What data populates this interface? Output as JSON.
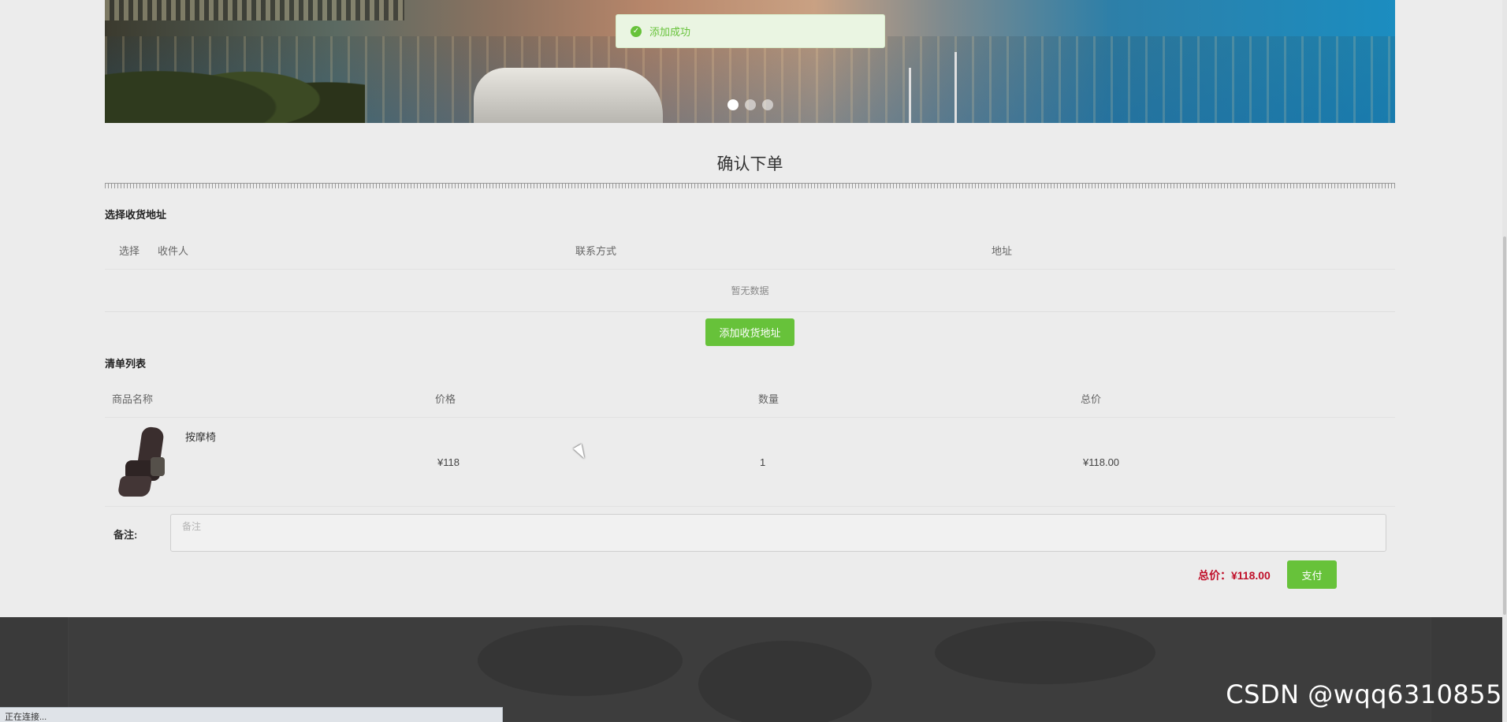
{
  "toast": {
    "message": "添加成功"
  },
  "page": {
    "title": "确认下单"
  },
  "address": {
    "section_label": "选择收货地址",
    "columns": [
      "选择",
      "收件人",
      "联系方式",
      "地址"
    ],
    "empty_text": "暂无数据",
    "add_button_label": "添加收货地址"
  },
  "cart": {
    "section_label": "清单列表",
    "columns": [
      "商品名称",
      "价格",
      "数量",
      "总价"
    ],
    "items": [
      {
        "name": "按摩椅",
        "price": "¥118",
        "quantity": "1",
        "total": "¥118.00"
      }
    ]
  },
  "remark": {
    "label": "备注:",
    "placeholder": "备注"
  },
  "summary": {
    "total_text": "总价：¥118.00",
    "pay_button_label": "支付"
  },
  "watermark": "CSDN @wqq6310855",
  "status_bar": "正在连接...",
  "colors": {
    "accent_green": "#67c23a",
    "total_red": "#c0102a",
    "footer_bg": "#3a3a3a"
  }
}
